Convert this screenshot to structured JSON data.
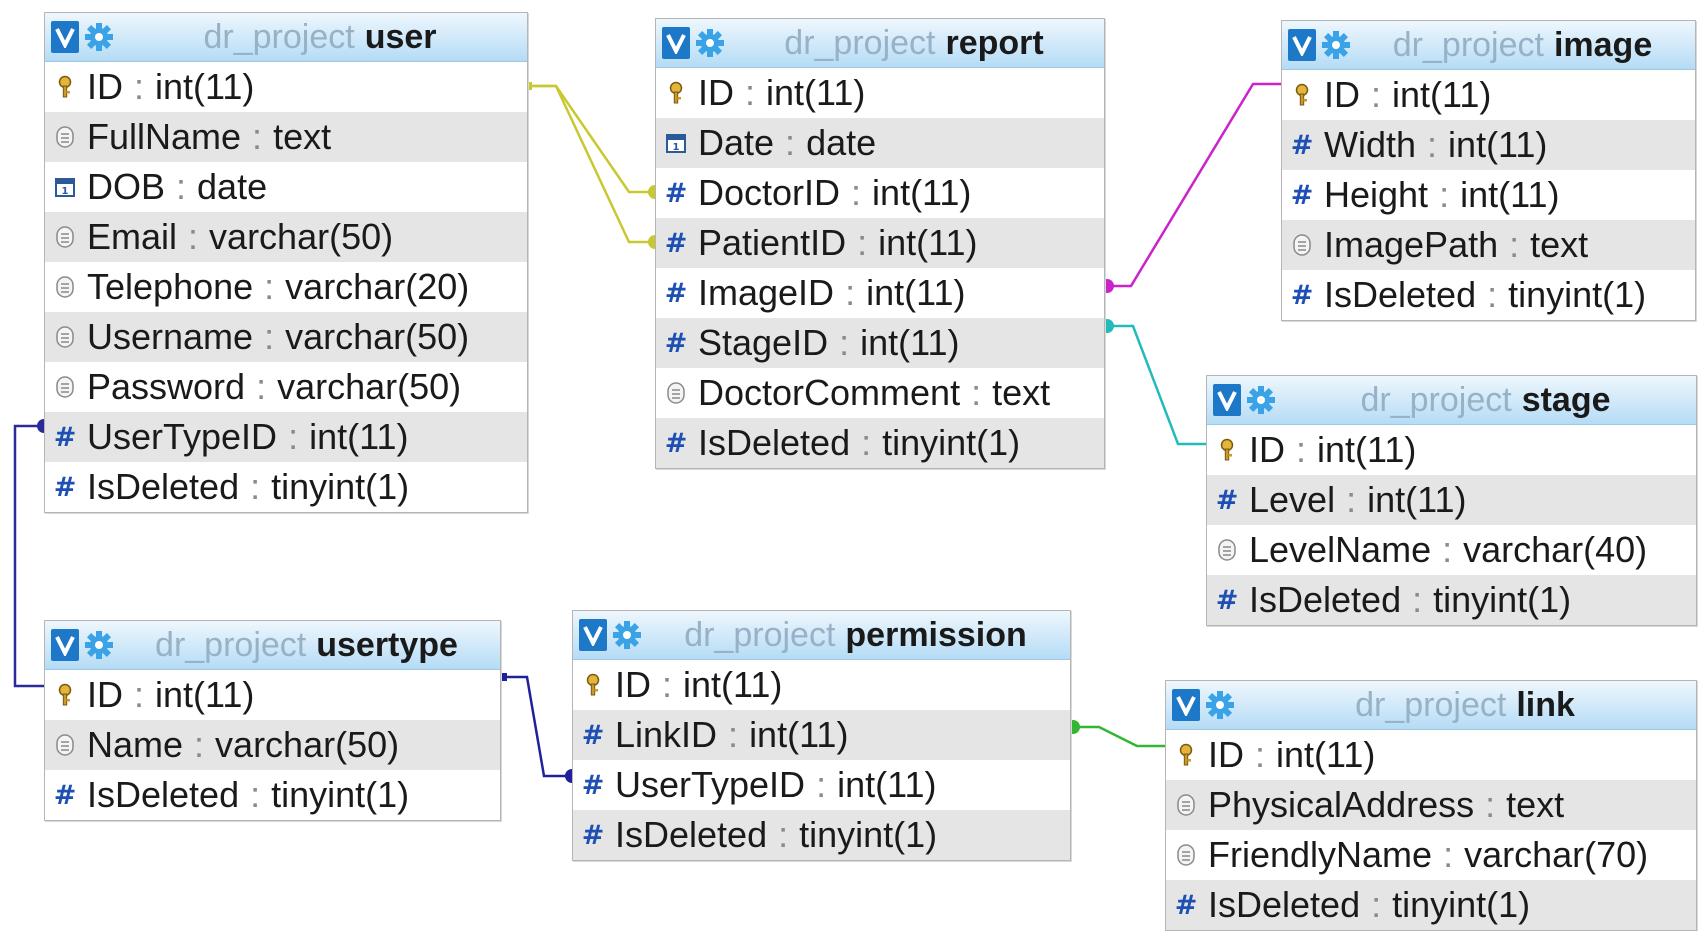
{
  "database": "dr_project",
  "colors": {
    "header_top": "#eef7fd",
    "header_bottom": "#b4dcf6",
    "checkbox": "#1e78c8",
    "gear": "#3aa3e8",
    "db_name": "#97b1c6",
    "alt_row": "#e5e5e5",
    "numeric_icon": "#1d4fb4",
    "link_user_report": "#c8c832",
    "link_report_image": "#cc22cc",
    "link_report_stage": "#22bbbb",
    "link_user_usertype": "#2a2a9a",
    "link_usertype_permission": "#20209a",
    "link_permission_link": "#33b633"
  },
  "tables": [
    {
      "key": "user",
      "name": "user",
      "fields": [
        {
          "name": "ID",
          "type": "int(11)",
          "icon": "key-icon"
        },
        {
          "name": "FullName",
          "type": "text",
          "icon": "text-icon"
        },
        {
          "name": "DOB",
          "type": "date",
          "icon": "date-icon"
        },
        {
          "name": "Email",
          "type": "varchar(50)",
          "icon": "text-icon"
        },
        {
          "name": "Telephone",
          "type": "varchar(20)",
          "icon": "text-icon"
        },
        {
          "name": "Username",
          "type": "varchar(50)",
          "icon": "text-icon"
        },
        {
          "name": "Password",
          "type": "varchar(50)",
          "icon": "text-icon"
        },
        {
          "name": "UserTypeID",
          "type": "int(11)",
          "icon": "hash-icon"
        },
        {
          "name": "IsDeleted",
          "type": "tinyint(1)",
          "icon": "hash-icon"
        }
      ]
    },
    {
      "key": "report",
      "name": "report",
      "fields": [
        {
          "name": "ID",
          "type": "int(11)",
          "icon": "key-icon"
        },
        {
          "name": "Date",
          "type": "date",
          "icon": "date-icon"
        },
        {
          "name": "DoctorID",
          "type": "int(11)",
          "icon": "hash-icon"
        },
        {
          "name": "PatientID",
          "type": "int(11)",
          "icon": "hash-icon"
        },
        {
          "name": "ImageID",
          "type": "int(11)",
          "icon": "hash-icon"
        },
        {
          "name": "StageID",
          "type": "int(11)",
          "icon": "hash-icon"
        },
        {
          "name": "DoctorComment",
          "type": "text",
          "icon": "text-icon"
        },
        {
          "name": "IsDeleted",
          "type": "tinyint(1)",
          "icon": "hash-icon"
        }
      ]
    },
    {
      "key": "image",
      "name": "image",
      "fields": [
        {
          "name": "ID",
          "type": "int(11)",
          "icon": "key-icon"
        },
        {
          "name": "Width",
          "type": "int(11)",
          "icon": "hash-icon"
        },
        {
          "name": "Height",
          "type": "int(11)",
          "icon": "hash-icon"
        },
        {
          "name": "ImagePath",
          "type": "text",
          "icon": "text-icon"
        },
        {
          "name": "IsDeleted",
          "type": "tinyint(1)",
          "icon": "hash-icon"
        }
      ]
    },
    {
      "key": "stage",
      "name": "stage",
      "fields": [
        {
          "name": "ID",
          "type": "int(11)",
          "icon": "key-icon"
        },
        {
          "name": "Level",
          "type": "int(11)",
          "icon": "hash-icon"
        },
        {
          "name": "LevelName",
          "type": "varchar(40)",
          "icon": "text-icon"
        },
        {
          "name": "IsDeleted",
          "type": "tinyint(1)",
          "icon": "hash-icon"
        }
      ]
    },
    {
      "key": "usertype",
      "name": "usertype",
      "fields": [
        {
          "name": "ID",
          "type": "int(11)",
          "icon": "key-icon"
        },
        {
          "name": "Name",
          "type": "varchar(50)",
          "icon": "text-icon"
        },
        {
          "name": "IsDeleted",
          "type": "tinyint(1)",
          "icon": "hash-icon"
        }
      ]
    },
    {
      "key": "permission",
      "name": "permission",
      "fields": [
        {
          "name": "ID",
          "type": "int(11)",
          "icon": "key-icon"
        },
        {
          "name": "LinkID",
          "type": "int(11)",
          "icon": "hash-icon"
        },
        {
          "name": "UserTypeID",
          "type": "int(11)",
          "icon": "hash-icon"
        },
        {
          "name": "IsDeleted",
          "type": "tinyint(1)",
          "icon": "hash-icon"
        }
      ]
    },
    {
      "key": "link",
      "name": "link",
      "fields": [
        {
          "name": "ID",
          "type": "int(11)",
          "icon": "key-icon"
        },
        {
          "name": "PhysicalAddress",
          "type": "text",
          "icon": "text-icon"
        },
        {
          "name": "FriendlyName",
          "type": "varchar(70)",
          "icon": "text-icon"
        },
        {
          "name": "IsDeleted",
          "type": "tinyint(1)",
          "icon": "hash-icon"
        }
      ]
    }
  ],
  "relations": [
    {
      "from": "report.DoctorID",
      "to": "user.ID",
      "color_key": "link_user_report"
    },
    {
      "from": "report.PatientID",
      "to": "user.ID",
      "color_key": "link_user_report"
    },
    {
      "from": "report.ImageID",
      "to": "image.ID",
      "color_key": "link_report_image"
    },
    {
      "from": "report.StageID",
      "to": "stage.ID",
      "color_key": "link_report_stage"
    },
    {
      "from": "user.UserTypeID",
      "to": "usertype.ID",
      "color_key": "link_user_usertype"
    },
    {
      "from": "permission.UserTypeID",
      "to": "usertype.ID",
      "color_key": "link_usertype_permission"
    },
    {
      "from": "permission.LinkID",
      "to": "link.ID",
      "color_key": "link_permission_link"
    }
  ]
}
